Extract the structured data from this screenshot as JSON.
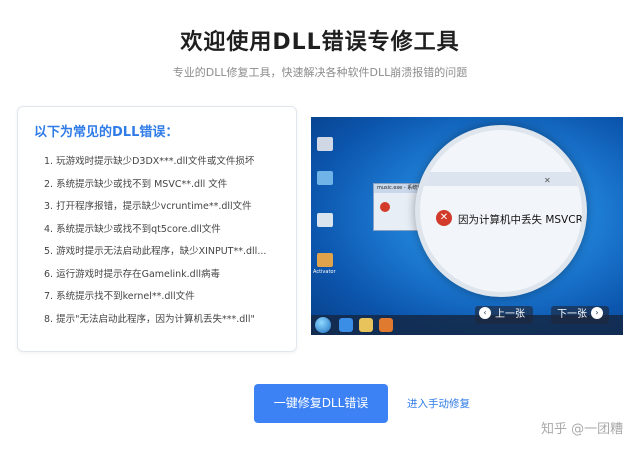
{
  "header": {
    "title": "欢迎使用DLL错误专修工具",
    "subtitle": "专业的DLL修复工具，快速解决各种软件DLL崩溃报错的问题"
  },
  "errors": {
    "heading": "以下为常见的DLL错误：",
    "items": [
      "1. 玩游戏时提示缺少D3DX***.dll文件或文件损坏",
      "2. 系统提示缺少或找不到 MSVC**.dll 文件",
      "3. 打开程序报错，提示缺少vcruntime**.dll文件",
      "4. 系统提示缺少或找不到qt5core.dll文件",
      "5. 游戏时提示无法启动此程序，缺少XINPUT**.dll...",
      "6. 运行游戏时提示存在Gamelink.dll病毒",
      "7. 系统提示找不到kernel**.dll文件",
      "8. 提示\"无法启动此程序，因为计算机丢失***.dll\""
    ]
  },
  "screenshot": {
    "window_title": "music.exe - 系统错误",
    "zoom_text": "因为计算机中丢失 MSVCRTD.dll。",
    "desktop_label": "Activator"
  },
  "carousel": {
    "prev_label": "上一张",
    "next_label": "下一张"
  },
  "actions": {
    "repair_label": "一键修复DLL错误",
    "manual_label": "进入手动修复"
  },
  "watermark": "知乎 @一团糟"
}
